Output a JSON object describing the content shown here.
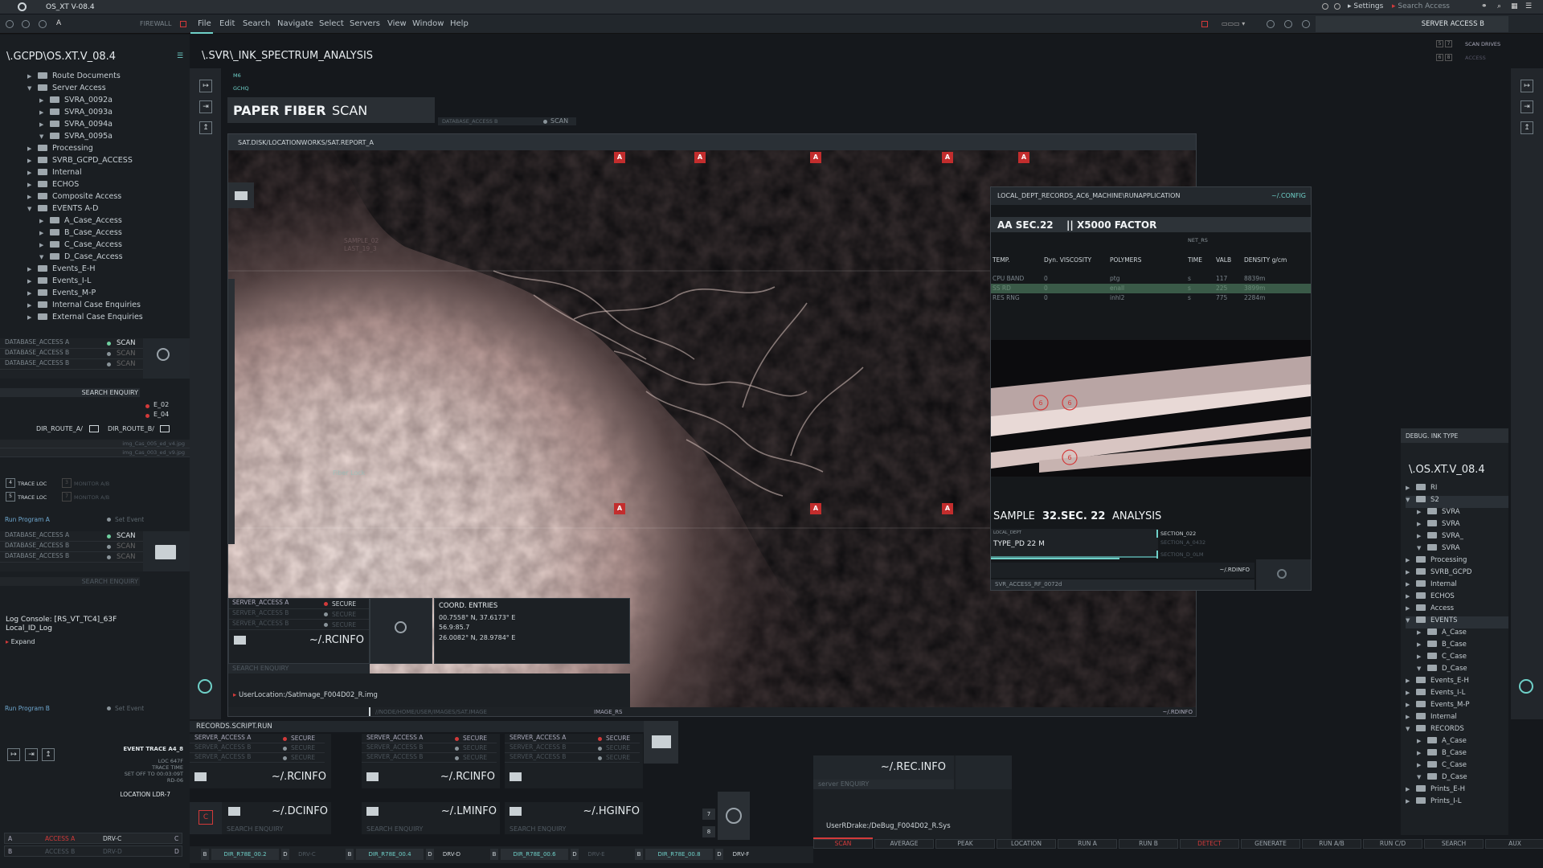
{
  "app": {
    "title": "OS_XT V-08.4",
    "firewall": "FIREWALL",
    "settings": "Settings",
    "search_access": "Search Access",
    "tab_label": "A"
  },
  "menu": [
    "File",
    "Edit",
    "Search",
    "Navigate",
    "Select",
    "Servers",
    "View",
    "Window",
    "Help"
  ],
  "server_access_tab": "SERVER ACCESS B",
  "scan_drives": "SCAN DRIVES",
  "access_small": "ACCESS",
  "left": {
    "path": "\\.GCPD\\OS.XT.V_08.4",
    "tree": [
      "Route Documents",
      "Server Access",
      "SVRA_0092a",
      "SVRA_0093a",
      "SVRA_0094a",
      "SVRA_0095a",
      "Processing",
      "SVRB_GCPD_ACCESS",
      "Internal",
      "ECHOS",
      "Composite Access",
      "EVENTS A-D",
      "A_Case_Access",
      "B_Case_Access",
      "C_Case_Access",
      "D_Case_Access",
      "Events_E-H",
      "Events_I-L",
      "Events_M-P",
      "Internal Case Enquiries",
      "External Case Enquiries"
    ],
    "db_rows": [
      "DATABASE_ACCESS A",
      "DATABASE_ACCESS B",
      "DATABASE_ACCESS B"
    ],
    "scan": "SCAN",
    "search_enquiry": "SEARCH ENQUIRY",
    "e02": "E_02",
    "e04": "E_04",
    "dir_a": "DIR_ROUTE_A/",
    "dir_b": "DIR_ROUTE_B/",
    "files": [
      "img_Cas_005_ed_v4.jpg",
      "img_Cas_003_ed_v9.jpg"
    ],
    "trace1": "TRACE LOC",
    "trace2": "TRACE LOC",
    "monitor1": "MONITOR A/B",
    "monitor2": "MONITOR A/B",
    "run_a": "Run Program A",
    "set_event": "Set Event",
    "run_b": "Run Program B",
    "console_line1": "Log Console: [RS_VT_TC4]_63F",
    "console_line2": "Local_ID_Log",
    "expand": "Expand",
    "event_trace": "EVENT TRACE A4_8",
    "loc": "LOC 647F",
    "trace_time": "TRACE TIME",
    "set_off": "SET OFF TO 00:03:09T",
    "rd": "RD-06",
    "location": "LOCATION  LDR-7",
    "access_a": "ACCESS A",
    "access_b": "ACCESS B",
    "drv_c": "DRV-C",
    "drv_d": "DRV-D",
    "letters": [
      "A",
      "B",
      "C",
      "D"
    ]
  },
  "main": {
    "path": "\\.SVR\\_INK_SPECTRUM_ANALYSIS",
    "m6": "M6",
    "gchq": "GCHQ",
    "title_bold": "PAPER FIBER",
    "title_light": "SCAN",
    "db_b": "DATABASE_ACCESS B",
    "scan": "SCAN",
    "image_path": "SAT.DISK/LOCATIONWORKS/SAT.REPORT_A",
    "sample_tag1": "SAMPLE_02",
    "sample_tag2": "LAST_19_3",
    "fiber_label": "Fiber Lock",
    "srv_rows": [
      "SERVER_ACCESS A",
      "SERVER_ACCESS B",
      "SERVER_ACCESS B"
    ],
    "secure": "SECURE",
    "rcinfo": "~/.RCINFO",
    "search_enquiry": "SEARCH ENQUIRY",
    "coord_title": "COORD. ENTRIES",
    "coord1": "00.7558° N, 37.6173° E",
    "coord2": "56.9:85.7",
    "coord3": "26.0082° N, 28.9784° E",
    "user_location": "UserLocation:/SatImage_F004D02_R.img",
    "footer_path": "//NODE/HOME/USER/IMAGES/SAT.IMAGE",
    "image_rs": "IMAGE_RS",
    "rdinfo": "~/.RDINFO"
  },
  "analysis": {
    "path": "LOCAL_DEPT_RECORDS_AC6_MACHINE\\RUNAPPLICATION",
    "config": "~/.CONFIG",
    "title1": "AA SEC.22",
    "title2": "|| X5000 FACTOR",
    "net": "NET_RS",
    "cols": [
      "TEMP.",
      "Dyn. VISCOSITY",
      "POLYMERS",
      "TIME",
      "VALB",
      "DENSITY g/cm"
    ],
    "rows": [
      [
        "CPU BAND",
        "0",
        "ptg",
        "s",
        "117",
        "8839m"
      ],
      [
        "SS RD",
        "0",
        "enall",
        "s",
        "225",
        "3899m"
      ],
      [
        "RES RNG",
        "0",
        "inhl2",
        "s",
        "775",
        "2284m"
      ]
    ],
    "sample": "SAMPLE",
    "sample_num": "32.SEC. 22",
    "analysis": "ANALYSIS",
    "local_dept": "LOCAL_DEPT",
    "type_pd": "TYPE_PD 22 M",
    "section1": "SECTION_022",
    "section2": "SECTION_A_0432",
    "section3": "SECTION_D_0LM",
    "rdinfo": "~/.RDINFO",
    "svr_access": "SVR_ACCESS_RF_0072d",
    "circles": [
      "6",
      "6",
      "6"
    ]
  },
  "records": {
    "title": "RECORDS.SCRIPT.RUN",
    "groups": [
      {
        "label": "~/.RCINFO"
      },
      {
        "label": "~/.RCINFO"
      },
      {
        "label": ""
      }
    ],
    "srv_rows": [
      "SERVER_ACCESS A",
      "SERVER_ACCESS B",
      "SERVER_ACCESS B"
    ],
    "secure": "SECURE",
    "info": [
      "~/.DCINFO",
      "~/.LMINFO",
      "~/.HGINFO"
    ],
    "search_enquiry": "SEARCH ENQUIRY",
    "nums": [
      "7",
      "8"
    ],
    "drives": [
      {
        "l": "B",
        "v": "DIR_R78E_00.2",
        "r": "D",
        "d": "DRV-C"
      },
      {
        "l": "B",
        "v": "DIR_R78E_00.4",
        "r": "D",
        "d": "DRV-D"
      },
      {
        "l": "B",
        "v": "DIR_R78E_00.6",
        "r": "D",
        "d": "DRV-E"
      },
      {
        "l": "B",
        "v": "DIR_R78E_00.8",
        "r": "D",
        "d": "DRV-F"
      }
    ]
  },
  "rec_info": {
    "title": "~/.REC.INFO",
    "server": "server ENQUIRY",
    "drake": "UserRDrake:/DeBug_F004D02_R.Sys"
  },
  "bottom_buttons": [
    "SCAN",
    "AVERAGE",
    "PEAK",
    "LOCATION",
    "RUN A",
    "RUN B",
    "DETECT",
    "GENERATE",
    "RUN A/B",
    "RUN C/D",
    "SEARCH",
    "AUX"
  ],
  "right": {
    "debug": "DEBUG. INK TYPE",
    "path": "\\.OS.XT.V_08.4",
    "tree": [
      "RI",
      "S2",
      "SVRA",
      "SVRA",
      "SVRA_",
      "SVRA",
      "Processing",
      "SVRB_GCPD",
      "Internal",
      "ECHOS",
      "Access",
      "EVENTS",
      "A_Case",
      "B_Case",
      "C_Case",
      "D_Case",
      "Events_E-H",
      "Events_I-L",
      "Events_M-P",
      "Internal",
      "RECORDS",
      "A_Case",
      "B_Case",
      "C_Case",
      "D_Case",
      "Prints_E-H",
      "Prints_I-L"
    ]
  },
  "colors": {
    "accent": "#6fd0c8",
    "alert": "#d33a3a",
    "bg": "#15181c"
  }
}
